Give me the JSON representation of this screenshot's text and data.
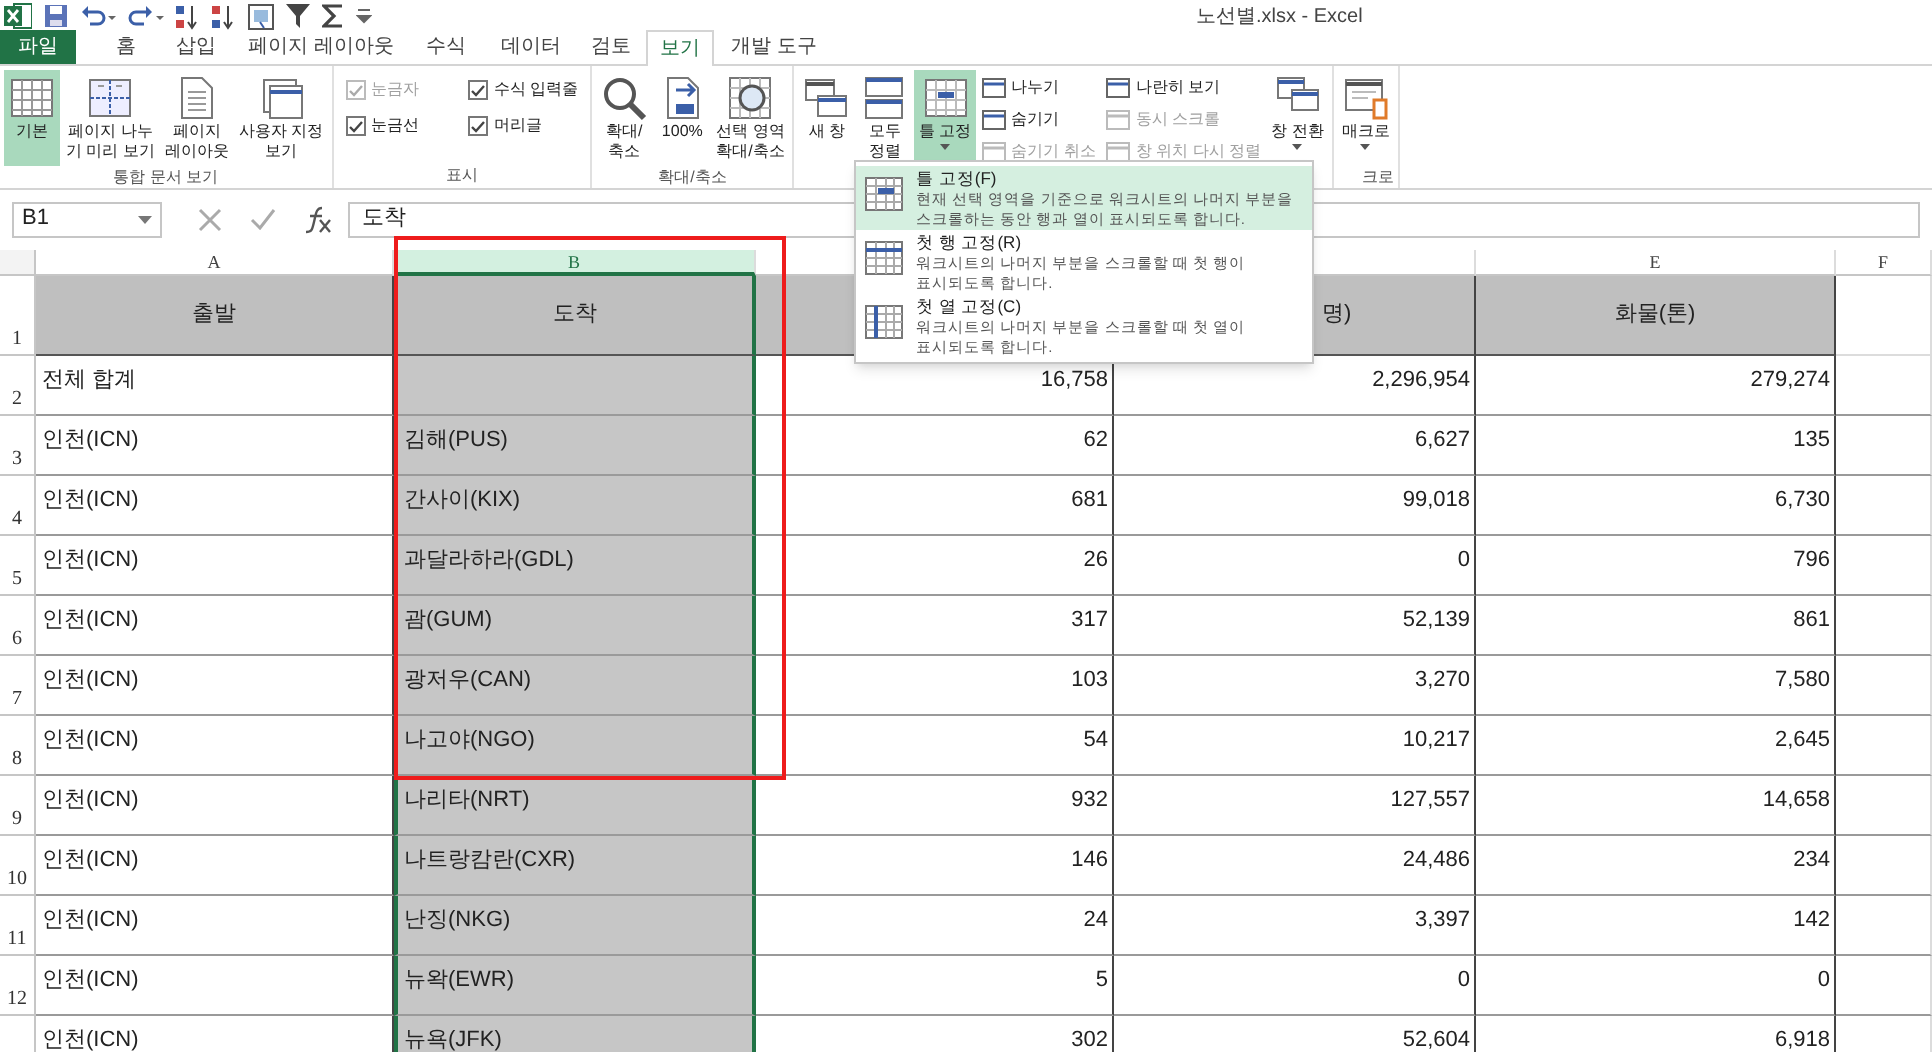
{
  "window": {
    "title": "노선별.xlsx - Excel"
  },
  "tabs": [
    {
      "label": "파일",
      "kind": "file",
      "selected": false
    },
    {
      "label": "홈",
      "kind": "tab",
      "selected": false
    },
    {
      "label": "삽입",
      "kind": "tab",
      "selected": false
    },
    {
      "label": "페이지 레이아웃",
      "kind": "tab",
      "selected": false
    },
    {
      "label": "수식",
      "kind": "tab",
      "selected": false
    },
    {
      "label": "데이터",
      "kind": "tab",
      "selected": false
    },
    {
      "label": "검토",
      "kind": "tab",
      "selected": false
    },
    {
      "label": "보기",
      "kind": "tab",
      "selected": true
    },
    {
      "label": "개발 도구",
      "kind": "tab",
      "selected": false
    }
  ],
  "ribbon": {
    "groups": [
      {
        "label": "통합 문서 보기",
        "items": [
          {
            "kind": "large",
            "label": "기본",
            "selected": true
          },
          {
            "kind": "large",
            "label": "페이지 나누\n기 미리 보기",
            "selected": false
          },
          {
            "kind": "large",
            "label": "페이지\n레이아웃",
            "selected": false
          },
          {
            "kind": "large",
            "label": "사용자 지정\n보기",
            "selected": false
          }
        ]
      },
      {
        "label": "표시",
        "items": [
          {
            "kind": "check",
            "label": "눈금자",
            "checked": true,
            "disabled": true
          },
          {
            "kind": "check",
            "label": "수식 입력줄",
            "checked": true,
            "disabled": false
          },
          {
            "kind": "check",
            "label": "눈금선",
            "checked": true,
            "disabled": false
          },
          {
            "kind": "check",
            "label": "머리글",
            "checked": true,
            "disabled": false
          }
        ]
      },
      {
        "label": "확대/축소",
        "items": [
          {
            "kind": "large",
            "label": "확대/\n축소",
            "selected": false
          },
          {
            "kind": "large",
            "label": "100%",
            "selected": false
          },
          {
            "kind": "large",
            "label": "선택 영역\n확대/축소",
            "selected": false
          }
        ]
      },
      {
        "items": [
          {
            "kind": "large",
            "label": "새 창",
            "selected": false
          },
          {
            "kind": "large",
            "label": "모두\n정렬",
            "selected": false
          },
          {
            "kind": "large",
            "label": "틀 고정",
            "selected": true,
            "menu": true
          },
          {
            "kind": "small",
            "label": "나누기",
            "disabled": false
          },
          {
            "kind": "small",
            "label": "숨기기",
            "disabled": false
          },
          {
            "kind": "small",
            "label": "숨기기 취소",
            "disabled": true
          },
          {
            "kind": "small",
            "label": "나란히 보기",
            "disabled": false
          },
          {
            "kind": "small",
            "label": "동시 스크롤",
            "disabled": true
          },
          {
            "kind": "small",
            "label": "창 위치 다시 정렬",
            "disabled": true
          },
          {
            "kind": "large",
            "label": "창 전환",
            "selected": false,
            "menu": true
          }
        ]
      },
      {
        "label": "크로",
        "items": [
          {
            "kind": "large",
            "label": "매크로",
            "selected": false,
            "menu": true
          }
        ]
      }
    ]
  },
  "formula_bar": {
    "name_box": "B1",
    "formula": "도착"
  },
  "sheet": {
    "columns": [
      {
        "letter": "A",
        "selected": false
      },
      {
        "letter": "B",
        "selected": true
      },
      {
        "selected": false
      },
      {
        "selected": false
      },
      {
        "letter": "E",
        "selected": false
      },
      {
        "letter": "F",
        "selected": false
      }
    ],
    "rows": [
      {
        "number": "1",
        "kind": "header",
        "cells": [
          "출발",
          "도착",
          null,
          "명)",
          "화물(톤)",
          null
        ]
      },
      {
        "number": "2",
        "kind": "data",
        "cells": [
          "전체 합계",
          null,
          "16,758",
          "2,296,954",
          "279,274",
          null
        ]
      },
      {
        "number": "3",
        "kind": "data",
        "cells": [
          "인천(ICN)",
          "김해(PUS)",
          "62",
          "6,627",
          "135",
          null
        ]
      },
      {
        "number": "4",
        "kind": "data",
        "cells": [
          "인천(ICN)",
          "간사이(KIX)",
          "681",
          "99,018",
          "6,730",
          null
        ]
      },
      {
        "number": "5",
        "kind": "data",
        "cells": [
          "인천(ICN)",
          "과달라하라(GDL)",
          "26",
          "0",
          "796",
          null
        ]
      },
      {
        "number": "6",
        "kind": "data",
        "cells": [
          "인천(ICN)",
          "괌(GUM)",
          "317",
          "52,139",
          "861",
          null
        ]
      },
      {
        "number": "7",
        "kind": "data",
        "cells": [
          "인천(ICN)",
          "광저우(CAN)",
          "103",
          "3,270",
          "7,580",
          null
        ]
      },
      {
        "number": "8",
        "kind": "data",
        "cells": [
          "인천(ICN)",
          "나고야(NGO)",
          "54",
          "10,217",
          "2,645",
          null
        ]
      },
      {
        "number": "9",
        "kind": "data",
        "cells": [
          "인천(ICN)",
          "나리타(NRT)",
          "932",
          "127,557",
          "14,658",
          null
        ]
      },
      {
        "number": "10",
        "kind": "data",
        "cells": [
          "인천(ICN)",
          "나트랑캄란(CXR)",
          "146",
          "24,486",
          "234",
          null
        ]
      },
      {
        "number": "11",
        "kind": "data",
        "cells": [
          "인천(ICN)",
          "난징(NKG)",
          "24",
          "3,397",
          "142",
          null
        ]
      },
      {
        "number": "12",
        "kind": "data",
        "cells": [
          "인천(ICN)",
          "뉴왁(EWR)",
          "5",
          "0",
          "0",
          null
        ]
      },
      {
        "kind": "data",
        "cells": [
          "인천(ICN)",
          "뉴욕(JFK)",
          "302",
          "52,604",
          "6,918",
          null
        ]
      }
    ]
  },
  "freeze_menu": {
    "items": [
      {
        "title": "틀 고정(F)",
        "description": "현재 선택 영역을 기준으로 워크시트의 나머지 부분을\n스크롤하는 동안 행과 열이 표시되도록 합니다.",
        "selected": true
      },
      {
        "title": "첫 행 고정(R)",
        "description": "워크시트의 나머지 부분을 스크롤할 때 첫 행이\n표시되도록 합니다.",
        "selected": false
      },
      {
        "title": "첫 열 고정(C)",
        "description": "워크시트의 나머지 부분을 스크롤할 때 첫 열이\n표시되도록 합니다.",
        "selected": false
      }
    ]
  },
  "annotation": {
    "kind": "rectangle"
  }
}
